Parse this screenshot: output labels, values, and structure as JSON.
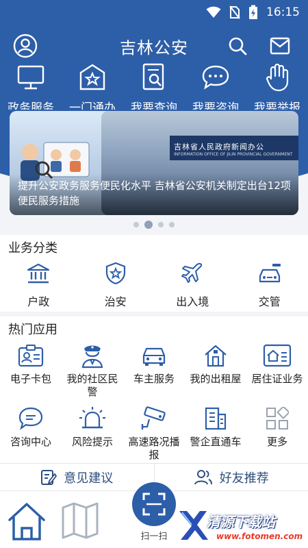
{
  "status_bar": {
    "time": "16:15"
  },
  "header": {
    "title": "吉林公安"
  },
  "services": [
    {
      "label": "政务服务",
      "icon": "monitor-icon"
    },
    {
      "label": "一门通办",
      "icon": "building-star-icon"
    },
    {
      "label": "我要查询",
      "icon": "document-search-icon"
    },
    {
      "label": "我要咨询",
      "icon": "chat-bubble-icon"
    },
    {
      "label": "我要举报",
      "icon": "raised-hand-icon"
    }
  ],
  "banner": {
    "caption": "提升公安政务服务便民化水平 吉林省公安机关制定出台12项便民服务措施",
    "backdrop_title": "吉林省人民政府新闻办公",
    "backdrop_subtitle": "INFORMATION OFFICE OF JILIN PROVINCIAL GOVERNMENT",
    "page_count": 4,
    "active_index": 1
  },
  "categories": {
    "title": "业务分类",
    "items": [
      {
        "label": "户政",
        "icon": "bank-icon"
      },
      {
        "label": "治安",
        "icon": "shield-star-icon"
      },
      {
        "label": "出入境",
        "icon": "airplane-icon"
      },
      {
        "label": "交管",
        "icon": "car-icon"
      }
    ]
  },
  "hot_apps": {
    "title": "热门应用",
    "items": [
      {
        "label": "电子卡包",
        "icon": "id-card-icon"
      },
      {
        "label": "我的社区民警",
        "icon": "police-officer-icon"
      },
      {
        "label": "车主服务",
        "icon": "car-front-icon"
      },
      {
        "label": "我的出租屋",
        "icon": "house-icon"
      },
      {
        "label": "居住证业务",
        "icon": "residence-card-icon"
      },
      {
        "label": "咨询中心",
        "icon": "consult-chat-icon"
      },
      {
        "label": "风险提示",
        "icon": "alarm-light-icon"
      },
      {
        "label": "高速路况播报",
        "icon": "camera-icon"
      },
      {
        "label": "警企直通车",
        "icon": "office-building-icon"
      },
      {
        "label": "更多",
        "icon": "more-grid-icon"
      }
    ]
  },
  "feedback": {
    "suggestion": "意见建议",
    "recommend": "好友推荐"
  },
  "tabbar": {
    "scan_label": "扫一扫"
  },
  "watermark": {
    "text": "清源下载站",
    "url": "www.fotomen.com"
  },
  "colors": {
    "primary": "#2d5ea8",
    "icon": "#2d5ea8"
  }
}
